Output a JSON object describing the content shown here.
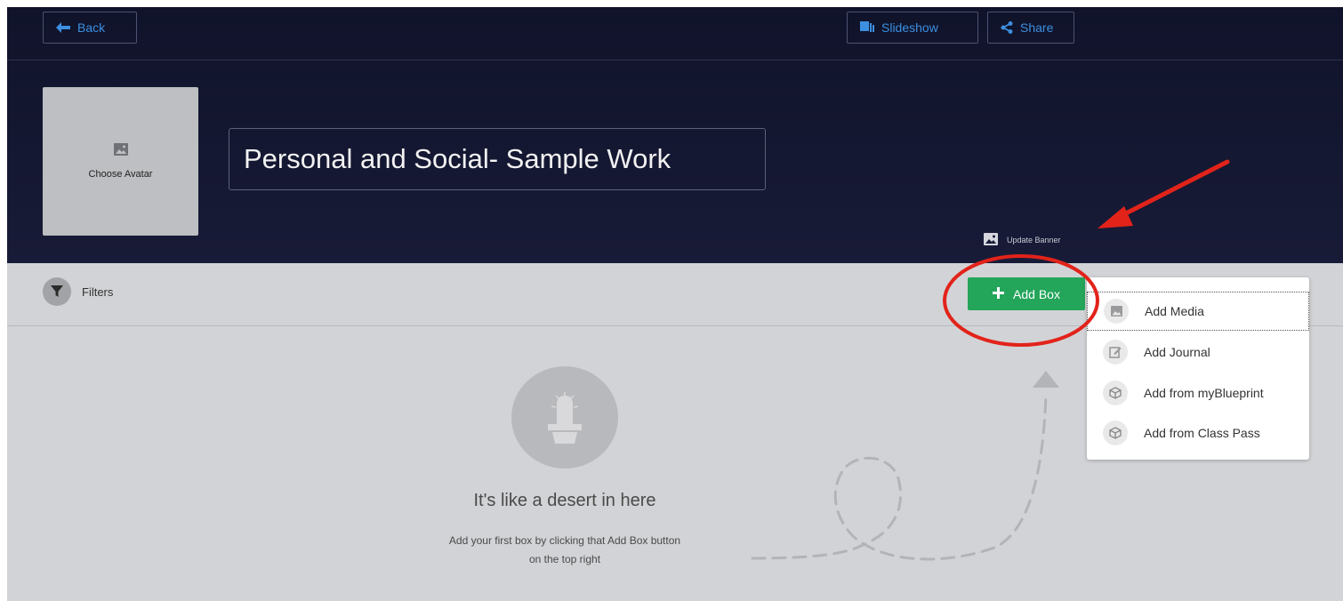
{
  "topbar": {
    "back_label": "Back",
    "slideshow_label": "Slideshow",
    "share_label": "Share"
  },
  "header": {
    "avatar_label": "Choose Avatar",
    "title": "Personal and Social- Sample Work",
    "update_banner_label": "Update Banner"
  },
  "toolbar": {
    "filters_label": "Filters",
    "add_box_label": "Add Box"
  },
  "add_menu": {
    "items": [
      {
        "label": "Add Media",
        "icon": "image-icon"
      },
      {
        "label": "Add Journal",
        "icon": "edit-icon"
      },
      {
        "label": "Add from myBlueprint",
        "icon": "cube-icon"
      },
      {
        "label": "Add from Class Pass",
        "icon": "cube-icon"
      }
    ]
  },
  "empty_state": {
    "icon": "cactus-icon",
    "title": "It's like a desert in here",
    "subtitle_line1": "Add your first box by clicking that Add Box button",
    "subtitle_line2": "on the top right"
  },
  "colors": {
    "header_bg": "#10132a",
    "link_blue": "#3d8fe0",
    "add_box_green": "#23a55a",
    "annotation_red": "#e2231a",
    "content_bg": "#d2d3d6"
  }
}
